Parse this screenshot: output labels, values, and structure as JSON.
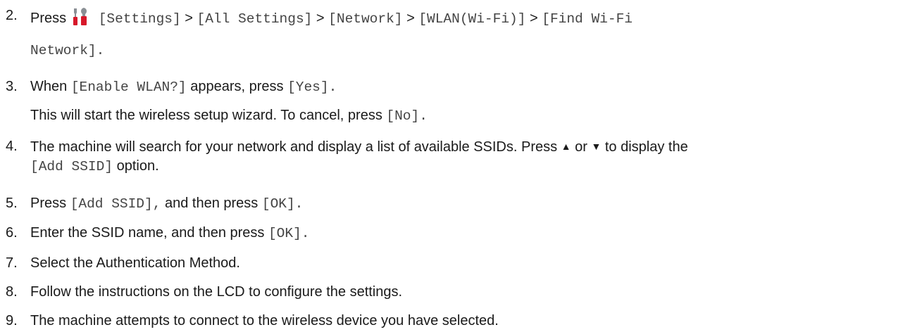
{
  "steps": [
    {
      "number": "2.",
      "press": "Press",
      "icon": "settings-tools-icon",
      "menu_path": [
        "[Settings]",
        "[All Settings]",
        "[Network]",
        "[WLAN(Wi-Fi)]",
        "[Find Wi-Fi"
      ],
      "separator": ">",
      "menu_path_cont": "Network]."
    },
    {
      "number": "3.",
      "text_a": "When",
      "code_a": "[Enable WLAN?]",
      "text_b": "appears, press",
      "code_b": "[Yes].",
      "line2_text": "This will start the wireless setup wizard. To cancel, press",
      "line2_code": "[No]."
    },
    {
      "number": "4.",
      "text_a": "The machine will search for your network and display a list of available SSIDs. Press",
      "up_symbol": "▲",
      "or": "or",
      "down_symbol": "▼",
      "text_b": "to display the",
      "code_a": "[Add SSID]",
      "text_c": "option."
    },
    {
      "number": "5.",
      "text_a": "Press",
      "code_a": "[Add SSID],",
      "text_b": "and then press",
      "code_b": "[OK]."
    },
    {
      "number": "6.",
      "text_a": "Enter the SSID name, and then press",
      "code_a": "[OK]."
    },
    {
      "number": "7.",
      "text": "Select the Authentication Method."
    },
    {
      "number": "8.",
      "text": "Follow the instructions on the LCD to configure the settings."
    },
    {
      "number": "9.",
      "text": "The machine attempts to connect to the wireless device you have selected."
    }
  ],
  "colors": {
    "text": "#1a1a1a",
    "code": "#444444",
    "icon_red": "#d7182a",
    "icon_gray": "#8a8f94"
  }
}
